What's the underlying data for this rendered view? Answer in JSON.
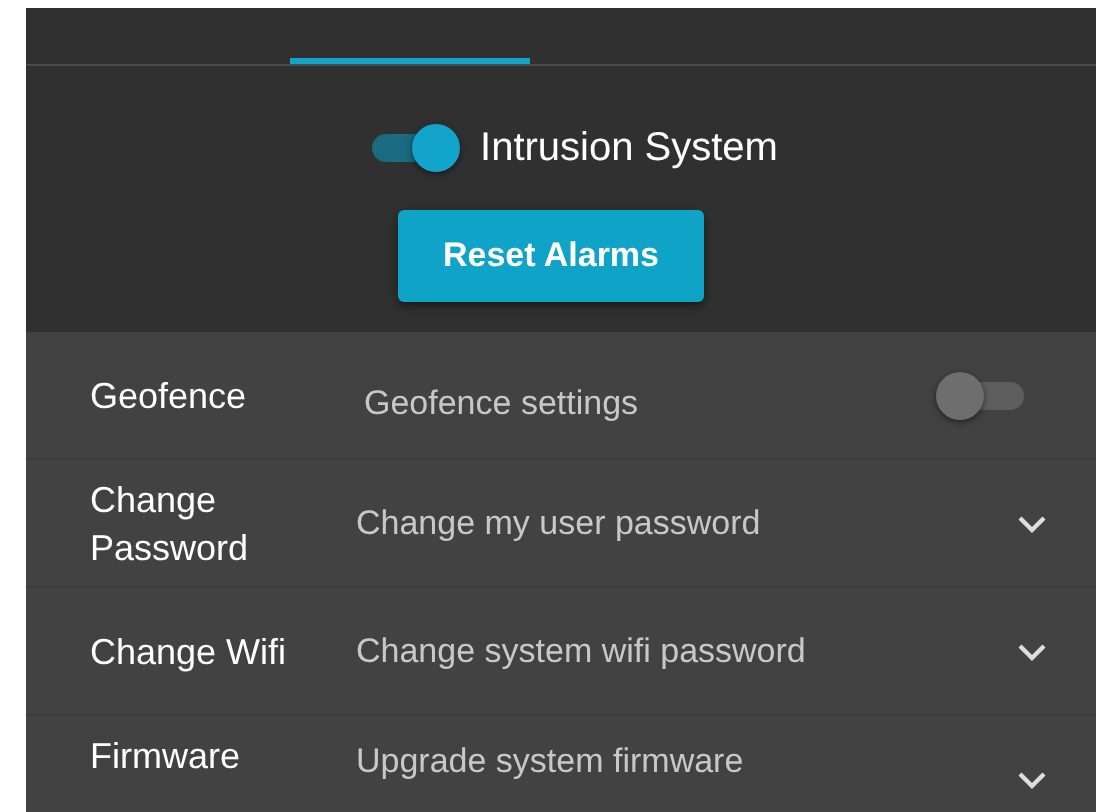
{
  "tabs": [
    {
      "selected": false
    },
    {
      "selected": true
    },
    {
      "selected": false
    }
  ],
  "master_switch": {
    "label": "Intrusion System",
    "on": true
  },
  "reset_button": {
    "label": "Reset Alarms"
  },
  "settings": [
    {
      "kind": "toggle",
      "title": "Geofence",
      "description": "Geofence settings",
      "on": false
    },
    {
      "kind": "expand",
      "title": "Change Password",
      "description": "Change my user password",
      "expanded": false
    },
    {
      "kind": "expand",
      "title": "Change Wifi",
      "description": "Change system wifi password",
      "expanded": false
    },
    {
      "kind": "expand",
      "title": "Firmware",
      "description": "Upgrade system firmware",
      "expanded": false
    }
  ]
}
